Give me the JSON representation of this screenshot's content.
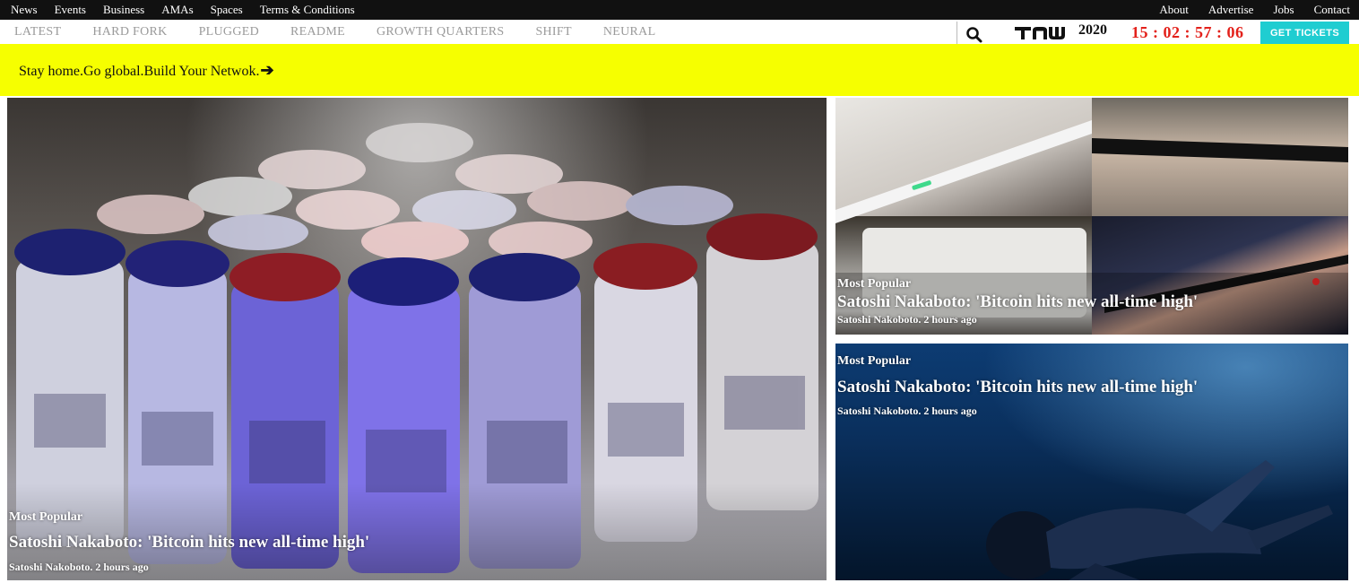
{
  "top_nav": {
    "left": [
      "News",
      "Events",
      "Business",
      "AMAs",
      "Spaces",
      "Terms & Conditions"
    ],
    "right": [
      "About",
      "Advertise",
      "Jobs",
      "Contact"
    ]
  },
  "category_nav": [
    "LATEST",
    "HARD FORK",
    "PLUGGED",
    "README",
    "GROWTH QUARTERS",
    "SHIFT",
    "NEURAL"
  ],
  "brand": {
    "logo_text": "TNW",
    "year": "2020",
    "countdown": "15 : 02 : 57 : 06",
    "tickets_label": "GET TICKETS"
  },
  "banner": {
    "text": "Stay home.Go global.Build Your Netwok.",
    "arrow": "➔"
  },
  "articles": [
    {
      "kicker": "Most Popular",
      "title": "Satoshi Nakaboto: 'Bitcoin hits new all-time high'",
      "byline": "Satoshi Nakoboto. 2 hours ago"
    },
    {
      "kicker": "Most Popular",
      "title": "Satoshi Nakaboto: 'Bitcoin hits new all-time high'",
      "byline": "Satoshi Nakoboto. 2 hours ago"
    },
    {
      "kicker": "Most Popular",
      "title": "Satoshi Nakaboto: 'Bitcoin hits new all-time high'",
      "byline": "Satoshi Nakoboto. 2 hours ago"
    }
  ],
  "colors": {
    "topbar": "#111111",
    "banner": "#f6ff00",
    "countdown": "#e3211b",
    "tickets_button": "#1fcdd1",
    "category_text": "#9a9a9a"
  },
  "icons": [
    "search-icon",
    "tnw-logo",
    "arrow-right-icon"
  ]
}
